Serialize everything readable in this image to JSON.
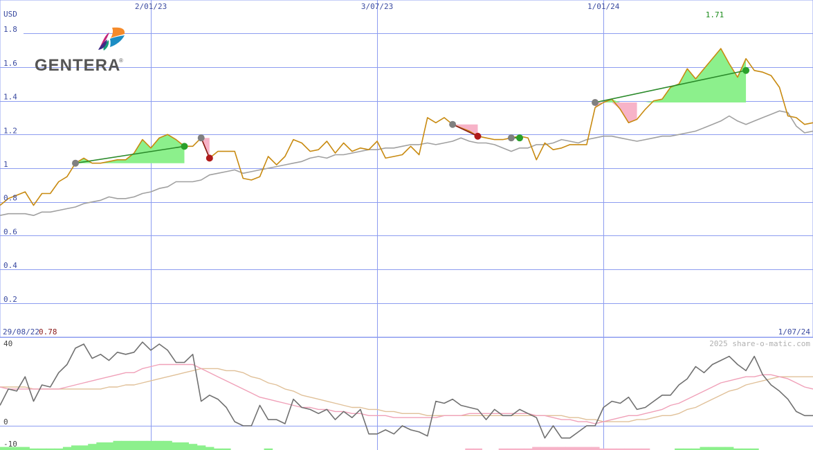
{
  "chart_data": [
    {
      "type": "line",
      "currency_label": "USD",
      "y_ticks": [
        "1.8",
        "1.6",
        "1.4",
        "1.2",
        "1",
        "0.8",
        "0.6",
        "0.4",
        "0.2"
      ],
      "ylim": [
        0,
        1.85
      ],
      "x_labels": [
        "2/01/23",
        "3/07/23",
        "1/01/24"
      ],
      "start_date": "29/08/22",
      "start_value": "0.78",
      "end_date": "1/07/24",
      "high_value": "1.71",
      "grid": true,
      "colors": {
        "price": "#c88a10",
        "index": "#a0a0a0",
        "grid": "#8c9cf0",
        "gain": "#8cf08c",
        "loss": "#f7b3c8",
        "up_trend": "#2a8a2a",
        "down_trend": "#8a1a1a",
        "high_label": "#1a8a1a",
        "low_label": "#8a1a1a",
        "axis_text": "#3a4aa0"
      },
      "series": [
        {
          "key": "price",
          "values": [
            0.78,
            0.82,
            0.84,
            0.86,
            0.78,
            0.85,
            0.85,
            0.92,
            0.95,
            1.03,
            1.06,
            1.03,
            1.03,
            1.04,
            1.05,
            1.05,
            1.09,
            1.17,
            1.12,
            1.18,
            1.2,
            1.17,
            1.13,
            1.13,
            1.18,
            1.06,
            1.1,
            1.1,
            1.1,
            0.94,
            0.93,
            0.95,
            1.07,
            1.02,
            1.07,
            1.17,
            1.15,
            1.1,
            1.11,
            1.16,
            1.09,
            1.15,
            1.1,
            1.12,
            1.11,
            1.16,
            1.06,
            1.07,
            1.08,
            1.13,
            1.08,
            1.3,
            1.27,
            1.3,
            1.26,
            1.24,
            1.22,
            1.19,
            1.18,
            1.17,
            1.17,
            1.18,
            1.19,
            1.18,
            1.05,
            1.15,
            1.11,
            1.12,
            1.14,
            1.14,
            1.14,
            1.36,
            1.39,
            1.41,
            1.35,
            1.27,
            1.29,
            1.35,
            1.4,
            1.41,
            1.48,
            1.5,
            1.59,
            1.53,
            1.59,
            1.65,
            1.71,
            1.62,
            1.54,
            1.65,
            1.58,
            1.57,
            1.55,
            1.48,
            1.31,
            1.3,
            1.26,
            1.27
          ]
        },
        {
          "key": "index",
          "values": [
            0.72,
            0.73,
            0.73,
            0.73,
            0.72,
            0.74,
            0.74,
            0.75,
            0.76,
            0.77,
            0.79,
            0.8,
            0.81,
            0.83,
            0.82,
            0.82,
            0.83,
            0.85,
            0.86,
            0.88,
            0.89,
            0.92,
            0.92,
            0.92,
            0.93,
            0.96,
            0.97,
            0.98,
            0.99,
            0.97,
            0.98,
            0.99,
            1.0,
            1.01,
            1.02,
            1.03,
            1.04,
            1.06,
            1.07,
            1.06,
            1.08,
            1.08,
            1.09,
            1.1,
            1.11,
            1.11,
            1.12,
            1.12,
            1.13,
            1.14,
            1.14,
            1.15,
            1.14,
            1.15,
            1.16,
            1.18,
            1.16,
            1.15,
            1.15,
            1.14,
            1.12,
            1.1,
            1.12,
            1.12,
            1.14,
            1.14,
            1.15,
            1.17,
            1.16,
            1.15,
            1.17,
            1.18,
            1.19,
            1.19,
            1.18,
            1.17,
            1.16,
            1.17,
            1.18,
            1.19,
            1.19,
            1.2,
            1.21,
            1.22,
            1.24,
            1.26,
            1.28,
            1.31,
            1.28,
            1.26,
            1.28,
            1.3,
            1.32,
            1.34,
            1.33,
            1.25,
            1.21,
            1.22
          ]
        }
      ],
      "trend_lines": [
        {
          "kind": "up",
          "from": [
            9,
            1.03
          ],
          "to": [
            22,
            1.13
          ]
        },
        {
          "kind": "down",
          "from": [
            24,
            1.18
          ],
          "to": [
            25,
            1.06
          ]
        },
        {
          "kind": "down",
          "from": [
            54,
            1.26
          ],
          "to": [
            57,
            1.19
          ]
        },
        {
          "kind": "up",
          "from": [
            61,
            1.18
          ],
          "to": [
            62,
            1.18
          ]
        },
        {
          "kind": "up",
          "from": [
            71,
            1.39
          ],
          "to": [
            89,
            1.58
          ]
        }
      ]
    },
    {
      "type": "line",
      "y_ticks": [
        "40",
        "0",
        "-10"
      ],
      "ylim": [
        -12,
        42
      ],
      "watermark": "2025 share-o-matic.com",
      "series": [
        {
          "key": "oscillator",
          "color": "#707070",
          "values": [
            10,
            18,
            17,
            24,
            12,
            20,
            19,
            26,
            30,
            38,
            40,
            33,
            35,
            32,
            36,
            35,
            36,
            41,
            37,
            40,
            37,
            31,
            31,
            35,
            12,
            15,
            13,
            9,
            2,
            0,
            0,
            10,
            3,
            3,
            1,
            13,
            9,
            8,
            6,
            8,
            3,
            7,
            4,
            8,
            -4,
            -4,
            -2,
            -4,
            0,
            -2,
            -3,
            -5,
            12,
            11,
            13,
            10,
            9,
            8,
            3,
            8,
            5,
            5,
            8,
            6,
            4,
            -6,
            0,
            -6,
            -6,
            -3,
            0,
            0,
            9,
            12,
            11,
            14,
            8,
            9,
            12,
            15,
            15,
            20,
            23,
            29,
            26,
            30,
            32,
            34,
            30,
            27,
            34,
            25,
            20,
            17,
            13,
            7,
            5,
            5
          ]
        },
        {
          "key": "fast-average",
          "color": "#f0a0b8",
          "values": [
            19,
            18,
            18,
            18,
            18,
            18,
            18,
            18,
            19,
            20,
            21,
            22,
            23,
            24,
            25,
            26,
            26,
            28,
            29,
            30,
            30,
            30,
            30,
            30,
            28,
            26,
            24,
            22,
            20,
            18,
            16,
            14,
            13,
            12,
            11,
            10,
            9,
            9,
            8,
            8,
            7,
            7,
            6,
            6,
            5,
            5,
            5,
            4,
            4,
            4,
            4,
            4,
            4,
            5,
            5,
            5,
            6,
            6,
            6,
            6,
            6,
            6,
            6,
            6,
            5,
            5,
            4,
            3,
            3,
            2,
            2,
            1,
            2,
            3,
            4,
            5,
            5,
            6,
            7,
            8,
            10,
            11,
            13,
            15,
            17,
            19,
            21,
            22,
            23,
            24,
            24,
            25,
            25,
            24,
            23,
            21,
            19,
            18
          ]
        },
        {
          "key": "slow-average",
          "color": "#e0c098",
          "values": [
            19,
            19,
            19,
            19,
            18,
            18,
            18,
            18,
            18,
            18,
            18,
            18,
            18,
            19,
            19,
            20,
            20,
            21,
            22,
            23,
            24,
            25,
            26,
            27,
            28,
            28,
            28,
            27,
            27,
            26,
            24,
            23,
            21,
            20,
            18,
            17,
            15,
            14,
            13,
            12,
            11,
            10,
            9,
            9,
            8,
            8,
            7,
            7,
            6,
            6,
            6,
            5,
            5,
            5,
            5,
            5,
            5,
            5,
            5,
            5,
            5,
            5,
            5,
            5,
            5,
            5,
            5,
            5,
            4,
            4,
            3,
            3,
            2,
            2,
            2,
            2,
            3,
            3,
            4,
            5,
            5,
            6,
            8,
            9,
            11,
            13,
            15,
            17,
            18,
            20,
            21,
            22,
            23,
            24,
            24,
            24,
            24,
            24
          ]
        },
        {
          "key": "histogram",
          "gain_color": "#8cf08c",
          "loss_color": "#f7b3c8",
          "values": [
            2,
            2,
            2,
            2,
            1,
            1,
            1,
            1,
            2,
            3,
            3,
            4,
            5,
            5,
            6,
            6,
            6,
            6,
            6,
            6,
            6,
            5,
            5,
            4,
            3,
            2,
            1,
            1,
            0,
            0,
            0,
            0,
            1,
            0,
            0,
            0,
            0,
            0,
            0,
            0,
            0,
            0,
            0,
            0,
            0,
            0,
            0,
            0,
            0,
            0,
            0,
            0,
            0,
            0,
            0,
            0,
            -1,
            -1,
            0,
            0,
            -1,
            -1,
            -1,
            -1,
            -2,
            -2,
            -2,
            -2,
            -2,
            -2,
            -2,
            -2,
            -1,
            -1,
            -1,
            -1,
            -1,
            -1,
            0,
            0,
            0,
            1,
            1,
            1,
            2,
            2,
            2,
            2,
            1,
            1,
            1,
            0,
            0,
            0,
            0,
            0,
            0,
            0
          ]
        }
      ]
    }
  ]
}
